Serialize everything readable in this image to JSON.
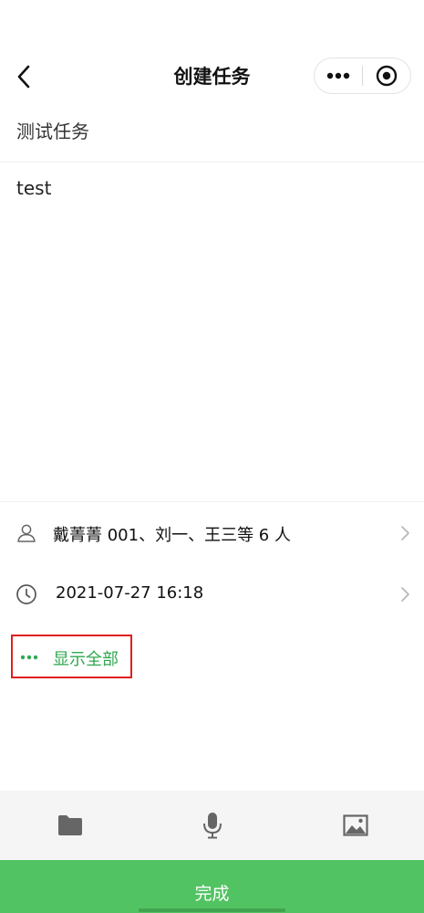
{
  "nav": {
    "title": "创建任务"
  },
  "task": {
    "title": "测试任务",
    "description": "test"
  },
  "members": {
    "text": "戴菁菁 001、刘一、王三等 6 人"
  },
  "deadline": {
    "text": "2021-07-27 16:18"
  },
  "show_all": {
    "label": "显示全部"
  },
  "footer": {
    "done_label": "完成"
  },
  "colors": {
    "accent_green": "#52c362",
    "link_green": "#2fa84f",
    "highlight_red": "#e02020",
    "toolbar_bg": "#f5f5f5",
    "icon_gray": "#666666"
  }
}
